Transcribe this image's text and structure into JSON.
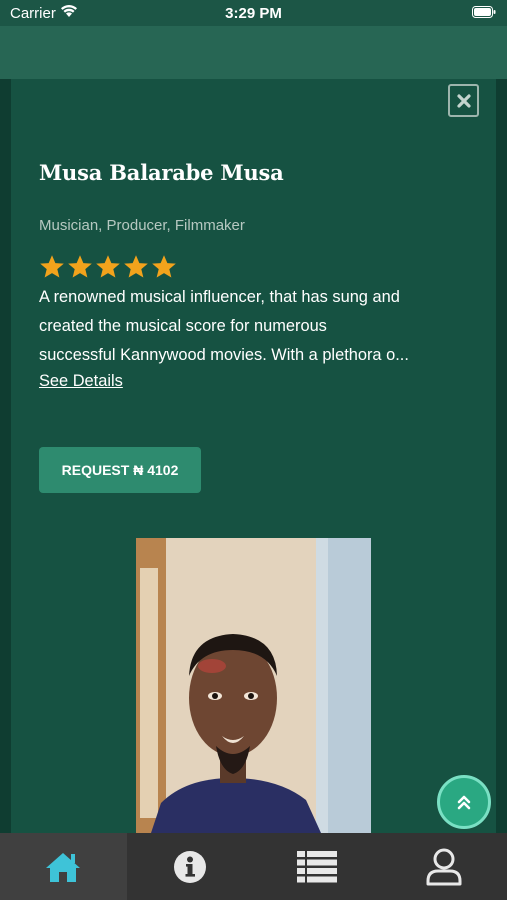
{
  "status_bar": {
    "carrier": "Carrier",
    "time": "3:29 PM"
  },
  "profile": {
    "name": "Musa Balarabe Musa",
    "roles": "Musician, Producer, Filmmaker",
    "rating": 5,
    "rating_max": 5,
    "description_lines": [
      "A renowned musical influencer, that has sung and",
      "created the musical score for numerous",
      "successful Kannywood movies. With a plethora o..."
    ],
    "see_details": "See Details",
    "request_button": "REQUEST ₦ 4102"
  },
  "icons": {
    "close": "close-icon",
    "scroll_top": "double-chevron-up-icon",
    "tabs": [
      "home-icon",
      "info-icon",
      "list-icon",
      "user-icon"
    ]
  },
  "colors": {
    "background": "#165242",
    "accent": "#2e8b6f",
    "star": "#f2a31c",
    "active_tab_icon": "#3ec3d8"
  }
}
